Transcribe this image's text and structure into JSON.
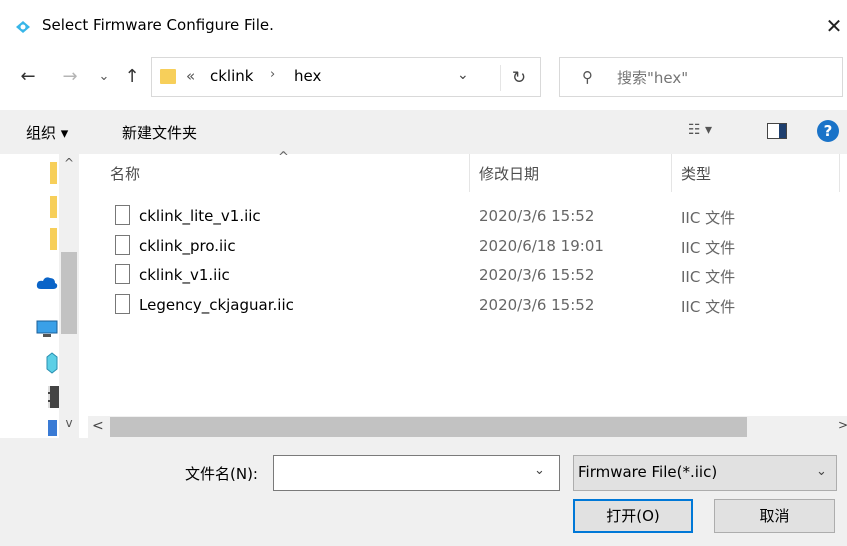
{
  "window": {
    "title": "Select Firmware Configure File.",
    "close_label": "✕"
  },
  "nav": {
    "back_icon": "←",
    "forward_icon": "→",
    "recent_icon": "⌄",
    "up_icon": "↑"
  },
  "address": {
    "overflow": "«",
    "crumbs": [
      "cklink",
      "hex"
    ],
    "separator": "›",
    "dropdown_icon": "⌄",
    "refresh_icon": "↻"
  },
  "search": {
    "icon": "⚲",
    "placeholder": "搜索\"hex\""
  },
  "toolbar": {
    "organize_label": "组织 ▾",
    "new_folder_label": "新建文件夹",
    "view_icon": "☷ ▾",
    "help_label": "?"
  },
  "navpane": {
    "scroll_up": "^",
    "scroll_down": "v"
  },
  "columns": {
    "name": "名称",
    "date": "修改日期",
    "type": "类型",
    "sort_indicator": "^"
  },
  "files": [
    {
      "name": "cklink_lite_v1.iic",
      "date": "2020/3/6 15:52",
      "type": "IIC 文件"
    },
    {
      "name": "cklink_pro.iic",
      "date": "2020/6/18 19:01",
      "type": "IIC 文件"
    },
    {
      "name": "cklink_v1.iic",
      "date": "2020/3/6 15:52",
      "type": "IIC 文件"
    },
    {
      "name": "Legency_ckjaguar.iic",
      "date": "2020/3/6 15:52",
      "type": "IIC 文件"
    }
  ],
  "hscroll": {
    "left": "<",
    "right": ">"
  },
  "footer": {
    "filename_label": "文件名(N):",
    "filename_value": "",
    "filename_dropdown": "⌄",
    "filetype_value": "Firmware File(*.iic)",
    "filetype_chevron": "⌄",
    "open_label": "打开(O)",
    "cancel_label": "取消"
  },
  "colors": {
    "folder": "#f7cf5a",
    "accent": "#0078d7",
    "help": "#1a73c8"
  }
}
